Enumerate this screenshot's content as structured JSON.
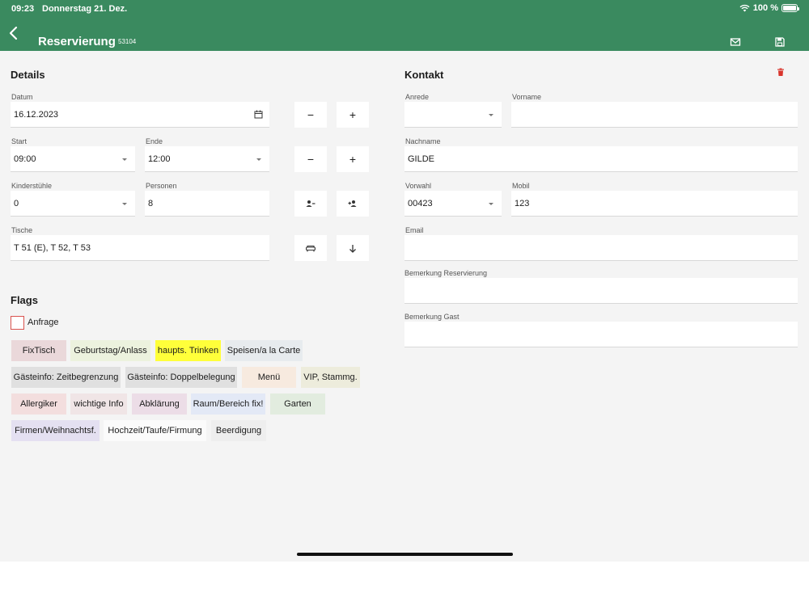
{
  "status": {
    "time": "09:23",
    "date": "Donnerstag 21. Dez.",
    "battery": "100 %"
  },
  "header": {
    "title": "Reservierung",
    "id": "53104",
    "icons": [
      "back-chevron-icon",
      "mail-icon",
      "save-icon"
    ]
  },
  "details": {
    "title": "Details",
    "datum": {
      "label": "Datum",
      "value": "16.12.2023",
      "icon": "calendar-icon"
    },
    "start": {
      "label": "Start",
      "value": "09:00"
    },
    "ende": {
      "label": "Ende",
      "value": "12:00"
    },
    "kinderstuehle": {
      "label": "Kinderstühle",
      "value": "0"
    },
    "personen": {
      "label": "Personen",
      "value": "8"
    },
    "tische": {
      "label": "Tische",
      "value": "T 51 (E), T 52, T 53"
    },
    "buttons": {
      "minus": "−",
      "plus": "+"
    },
    "icons": [
      "person-remove-icon",
      "person-add-icon",
      "couch-icon",
      "arrow-down-icon"
    ]
  },
  "kontakt": {
    "title": "Kontakt",
    "delete_icon": "trash-icon",
    "anrede": {
      "label": "Anrede",
      "value": ""
    },
    "vorname": {
      "label": "Vorname",
      "value": ""
    },
    "nachname": {
      "label": "Nachname",
      "value": "GILDE"
    },
    "vorwahl": {
      "label": "Vorwahl",
      "value": "00423"
    },
    "mobil": {
      "label": "Mobil",
      "value": "123"
    },
    "email": {
      "label": "Email",
      "value": ""
    },
    "bemerkung_reservierung": {
      "label": "Bemerkung Reservierung",
      "value": ""
    },
    "bemerkung_gast": {
      "label": "Bemerkung Gast",
      "value": ""
    }
  },
  "flags": {
    "title": "Flags",
    "anfrage": {
      "label": "Anfrage",
      "checked": false
    },
    "chips": [
      {
        "label": "FixTisch",
        "color": "#ead8da"
      },
      {
        "label": "Geburtstag/Anlass",
        "color": "#ecf2de"
      },
      {
        "label": "haupts. Trinken",
        "color": "#ffff3a"
      },
      {
        "label": "Speisen/a la Carte",
        "color": "#e7ebee"
      },
      {
        "label": "Gästeinfo: Zeitbegrenzung",
        "color": "#e0e0e0"
      },
      {
        "label": "Gästeinfo: Doppelbelegung",
        "color": "#e0e0e0"
      },
      {
        "label": "Menü",
        "color": "#f7eadf"
      },
      {
        "label": "VIP,  Stammg.",
        "color": "#edecdc"
      },
      {
        "label": "Allergiker",
        "color": "#f3dede"
      },
      {
        "label": "wichtige Info",
        "color": "#f0e5e6"
      },
      {
        "label": "Abklärung",
        "color": "#ecdde7"
      },
      {
        "label": "Raum/Bereich fix!",
        "color": "#e3e9f6"
      },
      {
        "label": "Garten",
        "color": "#e2ecdf"
      },
      {
        "label": "Firmen/Weihnachtsf.",
        "color": "#e4e0f1"
      },
      {
        "label": "Hochzeit/Taufe/Firmung",
        "color": "#fbfbfb"
      },
      {
        "label": "Beerdigung",
        "color": "#eeeeee"
      }
    ]
  }
}
